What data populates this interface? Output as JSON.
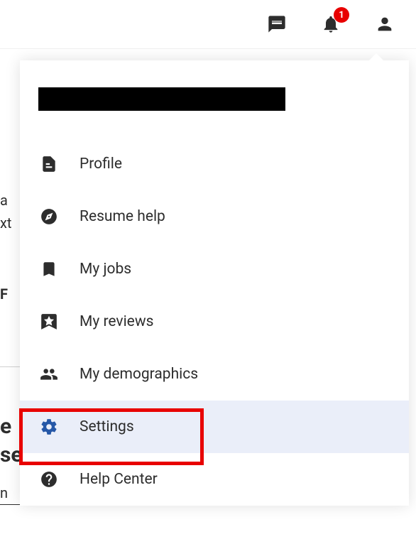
{
  "header": {
    "notifications_count": "1"
  },
  "bg": {
    "t1": "a",
    "t2": "xt",
    "t3": "F",
    "t4": "e",
    "t5": "se",
    "t6": "n"
  },
  "dropdown": {
    "items": [
      {
        "label": "Profile",
        "icon": "document-icon"
      },
      {
        "label": "Resume help",
        "icon": "compass-icon"
      },
      {
        "label": "My jobs",
        "icon": "bookmark-icon"
      },
      {
        "label": "My reviews",
        "icon": "star-badge-icon"
      },
      {
        "label": "My demographics",
        "icon": "people-icon"
      },
      {
        "label": "Settings",
        "icon": "gear-icon",
        "highlighted": true
      },
      {
        "label": "Help Center",
        "icon": "help-icon"
      }
    ]
  }
}
